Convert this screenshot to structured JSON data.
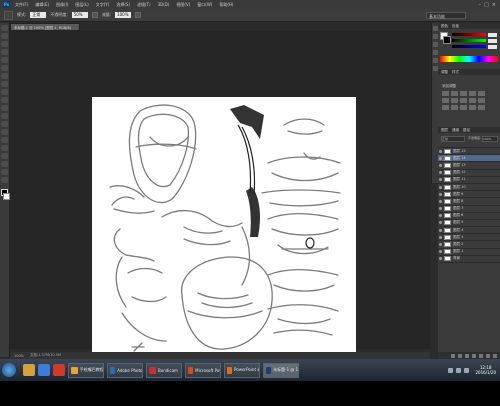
{
  "app": {
    "logo": "Ps",
    "menu": [
      "文件(F)",
      "编辑(E)",
      "图像(I)",
      "图层(L)",
      "文字(Y)",
      "选择(S)",
      "滤镜(T)",
      "3D(D)",
      "视图(V)",
      "窗口(W)",
      "帮助(H)"
    ],
    "window_controls": [
      "–",
      "□",
      "×"
    ]
  },
  "options": {
    "size_label": "模式:",
    "mode_value": "正常",
    "opacity_label": "不透明度:",
    "opacity_value": "50%",
    "flow_label": "流量:",
    "flow_value": "100%",
    "workspace": "基本功能"
  },
  "document": {
    "tab_title": "未标题-1 @ 100% (图层 1, RGB/8)",
    "status_zoom": "100%",
    "status_doc": "文档:1.37M/10.5M"
  },
  "panels": {
    "color_tabs": [
      "颜色",
      "色板"
    ],
    "adjustments_tabs": [
      "调整",
      "样式"
    ],
    "adjustments_title": "添加调整",
    "layers_tabs": [
      "图层",
      "通道",
      "路径"
    ],
    "blend_mode": "正常",
    "opacity_label": "不透明度:",
    "opacity_value": "100%",
    "layers": [
      "图层 15",
      "图层 14",
      "图层 13",
      "图层 12",
      "图层 11",
      "图层 10",
      "图层 9",
      "图层 8",
      "图层 7",
      "图层 6",
      "图层 5",
      "图层 4",
      "图层 3",
      "图层 2",
      "图层 1",
      "背景"
    ],
    "selected_layer_index": 1
  },
  "taskbar": {
    "items": [
      {
        "label": "手绘嘴巴教程",
        "color": "#e9a23b"
      },
      {
        "label": "Adobe Photosh...",
        "color": "#2b6cb0"
      },
      {
        "label": "Bandicam",
        "color": "#c53030"
      },
      {
        "label": "Microsoft Powe...",
        "color": "#d14b1f"
      },
      {
        "label": "PowerPoint 幻灯...",
        "color": "#e06a2c"
      },
      {
        "label": "未标题-1 @ 100...",
        "color": "#1b3f73"
      }
    ],
    "time": "12:18",
    "date": "2016/1/20"
  }
}
